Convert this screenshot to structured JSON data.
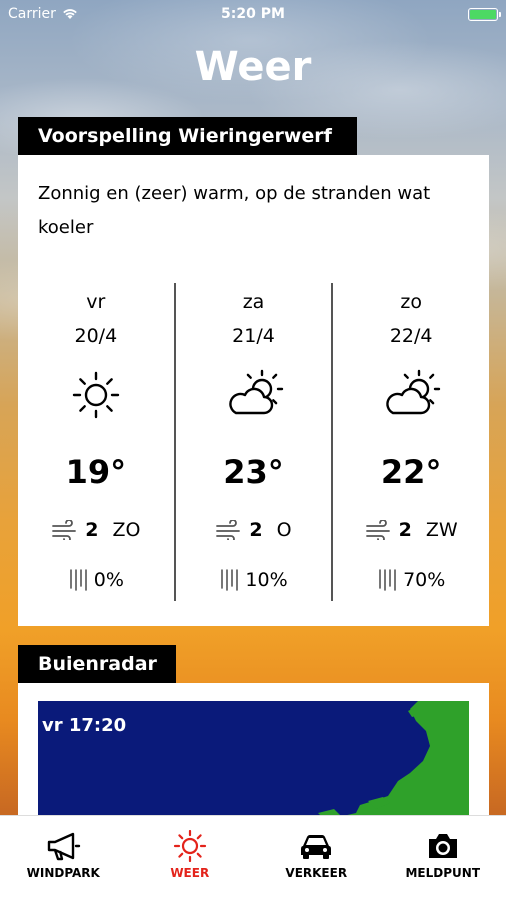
{
  "status_bar": {
    "carrier": "Carrier",
    "time": "5:20 PM"
  },
  "title": "Weer",
  "forecast": {
    "label": "Voorspelling Wieringerwerf",
    "summary": "Zonnig en (zeer) warm, op de stranden wat koeler",
    "days": [
      {
        "name": "vr",
        "date": "20/4",
        "icon": "sun-icon",
        "temp": "19°",
        "wind_speed": "2",
        "wind_dir": "ZO",
        "rain": "0%"
      },
      {
        "name": "za",
        "date": "21/4",
        "icon": "partly-cloudy-icon",
        "temp": "23°",
        "wind_speed": "2",
        "wind_dir": "O",
        "rain": "10%"
      },
      {
        "name": "zo",
        "date": "22/4",
        "icon": "partly-cloudy-icon",
        "temp": "22°",
        "wind_speed": "2",
        "wind_dir": "ZW",
        "rain": "70%"
      }
    ]
  },
  "radar": {
    "label": "Buienradar",
    "time": "vr 17:20"
  },
  "tabs": [
    {
      "label": "WINDPARK",
      "icon": "megaphone-icon",
      "active": false
    },
    {
      "label": "WEER",
      "icon": "sun-icon",
      "active": true
    },
    {
      "label": "VERKEER",
      "icon": "car-icon",
      "active": false
    },
    {
      "label": "MELDPUNT",
      "icon": "camera-icon",
      "active": false
    }
  ],
  "colors": {
    "accent": "#e3231b",
    "label_bg": "#000000",
    "radar_sea": "#0a1a7a",
    "radar_land": "#2fa12a"
  }
}
